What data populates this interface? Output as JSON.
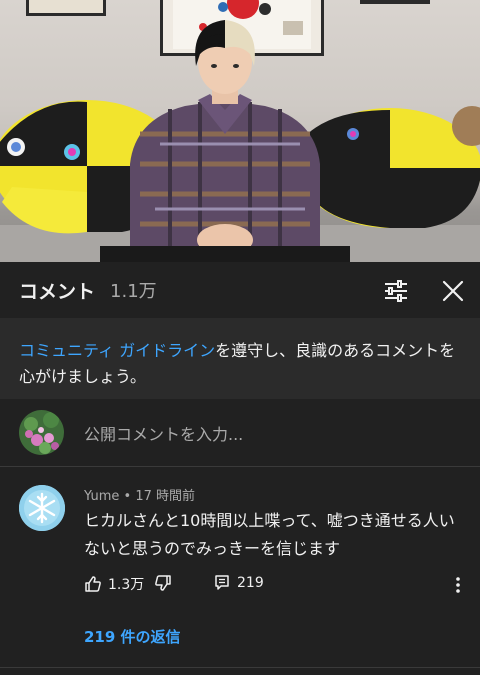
{
  "header": {
    "title": "コメント",
    "count": "1.1万",
    "filter_icon": "sliders-icon",
    "close_icon": "close-icon"
  },
  "banner": {
    "link": "コミュニティ ガイドライン",
    "text": "を遵守し、良識のあるコメントを心がけましょう。"
  },
  "input": {
    "placeholder": "公開コメントを入力..."
  },
  "comment": {
    "author": "Yume",
    "time": "17 時間前",
    "text": "ヒカルさんと10時間以上喋って、嘘つき通せる人いないと思うのでみっきーを信じます",
    "likes": "1.3万",
    "replies_count": "219",
    "replies_link": "219 件の返信"
  },
  "colors": {
    "background": "#212121",
    "banner": "#2b2b2b",
    "link": "#3ea6ff",
    "secondary_text": "#aaaaaa"
  }
}
